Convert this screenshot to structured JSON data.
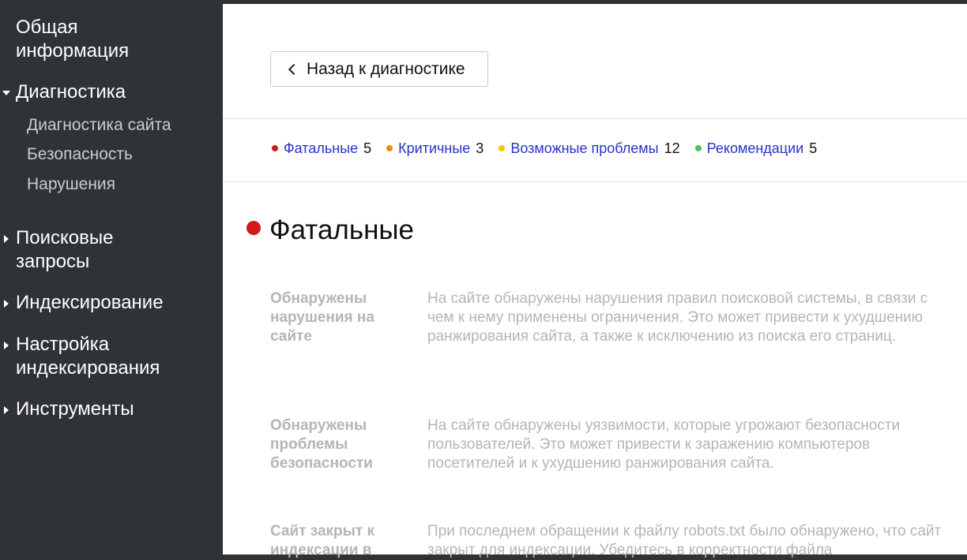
{
  "sidebar": {
    "overview": "Общая информация",
    "diagnostics": "Диагностика",
    "diagnostics_sub": {
      "site_diagnostics": "Диагностика сайта",
      "security": "Безопасность",
      "violations": "Нарушения"
    },
    "search_queries": "Поисковые запросы",
    "indexing": "Индексирование",
    "indexing_settings": "Настройка индексирования",
    "tools": "Инструменты"
  },
  "main": {
    "back_button": "Назад к диагностике",
    "filters": [
      {
        "label": "Фатальные",
        "count": "5",
        "color": "#d11a1a"
      },
      {
        "label": "Критичные",
        "count": "3",
        "color": "#f08c00"
      },
      {
        "label": "Возможные проблемы",
        "count": "12",
        "color": "#f5c800"
      },
      {
        "label": "Рекомендации",
        "count": "5",
        "color": "#4cc25a"
      }
    ],
    "section_title": "Фатальные",
    "issues": [
      {
        "name": "Обнаружены нарушения на сайте",
        "description": "На сайте обнаружены нарушения правил поисковой системы, в связи с чем к нему применены ограничения. Это может привести к ухудшению ранжирования сайта, а также к исключению из поиска его страниц."
      },
      {
        "name": "Обнаружены проблемы безопасности",
        "description": "На сайте обнаружены уязвимости, которые угрожают безопасности пользователей. Это может привести к заражению компьютеров посетителей и к ухудшению ранжирования сайта."
      },
      {
        "name": "Сайт закрыт к индексации в",
        "description": "При последнем обращении к файлу robots.txt было обнаружено, что сайт закрыт для индексации. Убедитесь в корректности файла"
      }
    ]
  }
}
